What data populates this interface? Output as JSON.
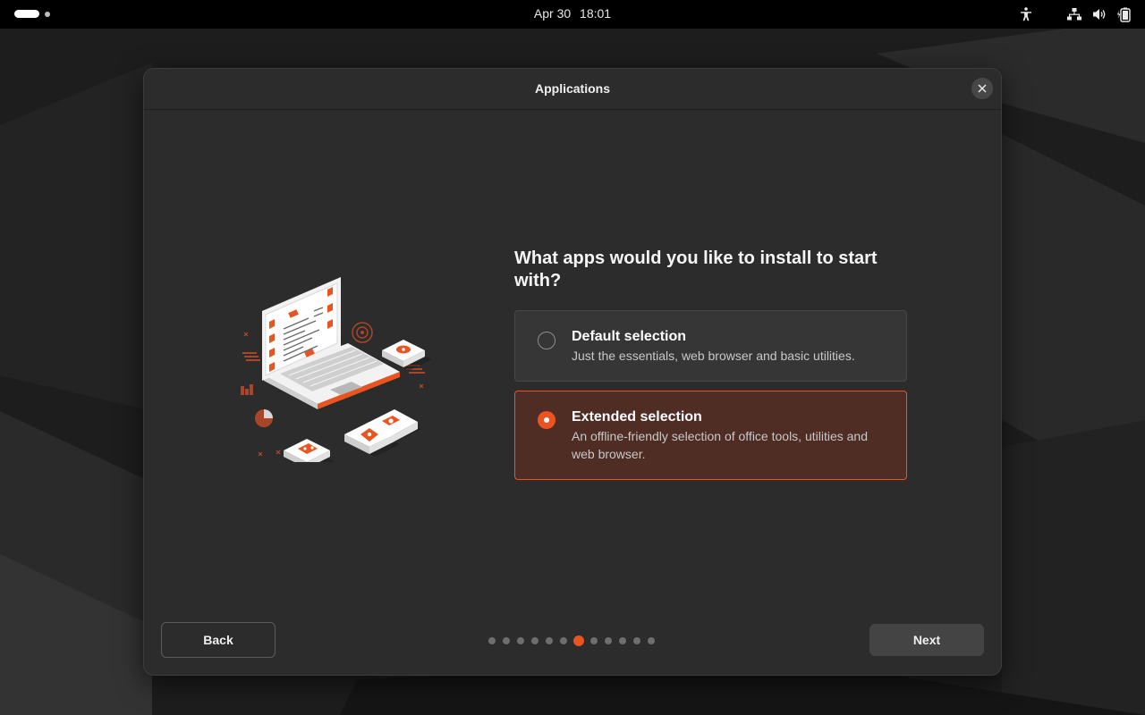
{
  "topbar": {
    "date": "Apr 30",
    "time": "18:01",
    "icons": [
      "activities-indicator",
      "accessibility-icon",
      "network-wired-icon",
      "volume-icon",
      "battery-icon"
    ]
  },
  "dialog": {
    "title": "Applications",
    "close_icon": "close-icon",
    "question": "What apps would you like to install to start with?",
    "options": [
      {
        "title": "Default selection",
        "description": "Just the essentials, web browser and basic utilities.",
        "selected": false
      },
      {
        "title": "Extended selection",
        "description": "An offline-friendly selection of office tools, utilities and web browser.",
        "selected": true
      }
    ],
    "back_label": "Back",
    "next_label": "Next",
    "pager": {
      "total": 12,
      "current": 7
    }
  },
  "colors": {
    "accent": "#e95420",
    "dialog_bg": "#2c2c2c",
    "selected_option_bg": "#4f2d24",
    "topbar_bg": "#000000"
  }
}
